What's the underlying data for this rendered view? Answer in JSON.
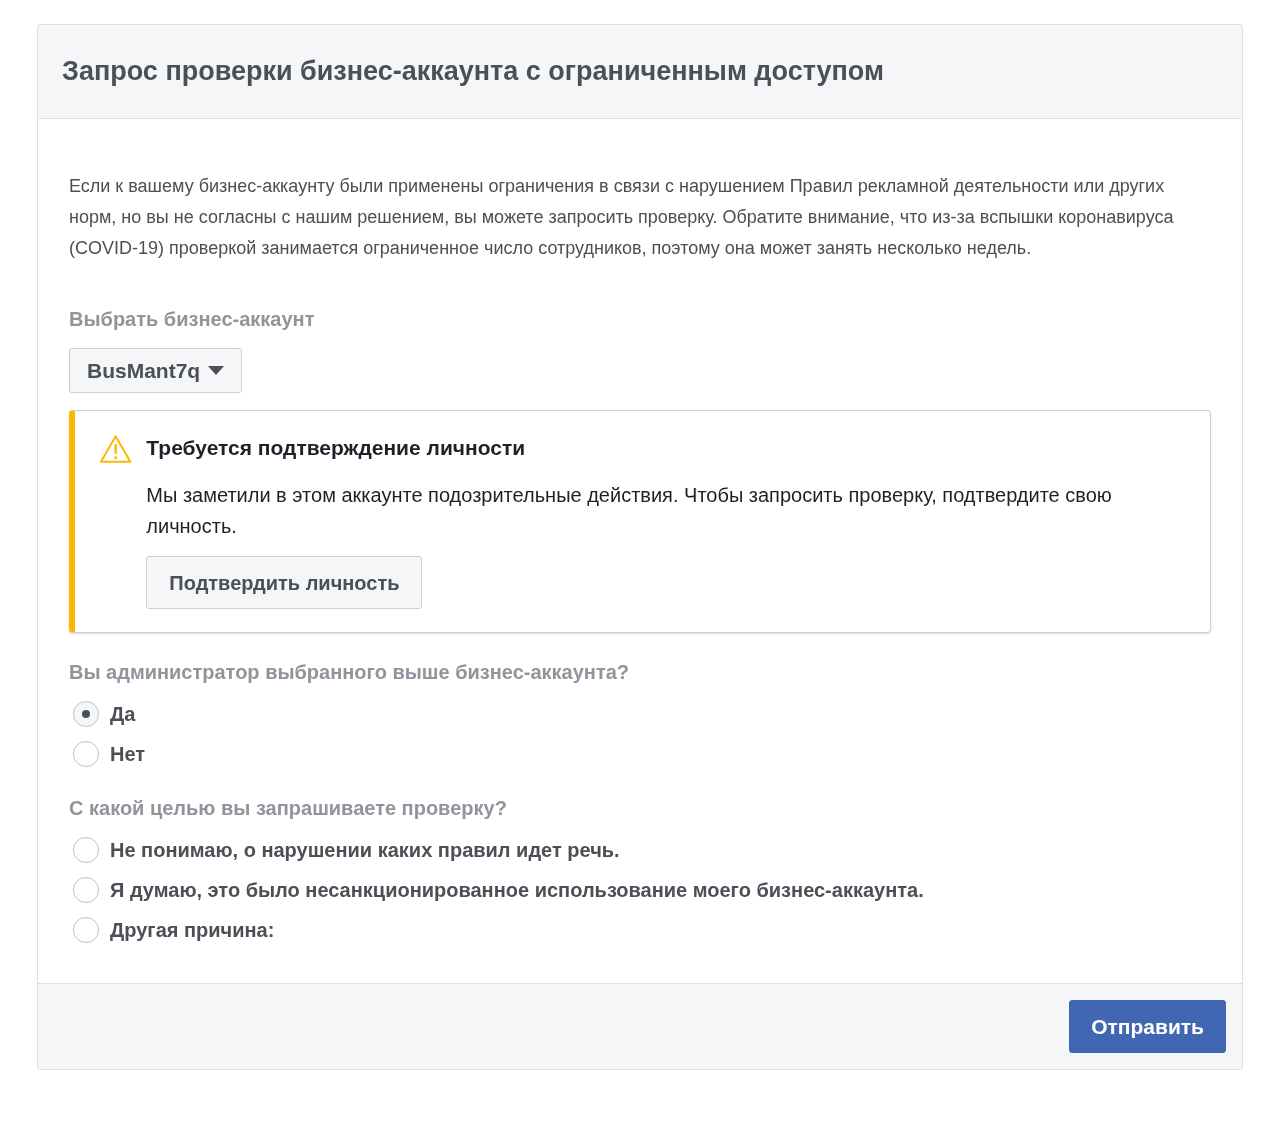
{
  "dialog": {
    "title": "Запрос проверки бизнес-аккаунта с ограниченным доступом"
  },
  "intro": "Если к вашему бизнес-аккаунту были применены ограничения в связи с нарушением Правил рекламной деятельности или других норм, но вы не согласны с нашим решением, вы можете запросить проверку. Обратите внимание, что из-за вспышки коронавируса (COVID-19) проверкой занимается ограниченное число сотрудников, поэтому она может занять несколько недель.",
  "account_select": {
    "label": "Выбрать бизнес-аккаунт",
    "value": "BusMant7q"
  },
  "alert": {
    "title": "Требуется подтверждение личности",
    "message": "Мы заметили в этом аккаунте подозрительные действия. Чтобы запросить проверку, подтвердите свою личность.",
    "button": "Подтвердить личность"
  },
  "questions": [
    {
      "label": "Вы администратор выбранного выше бизнес-аккаунта?",
      "options": [
        {
          "label": "Да",
          "selected": true
        },
        {
          "label": "Нет",
          "selected": false
        }
      ]
    },
    {
      "label": "С какой целью вы запрашиваете проверку?",
      "options": [
        {
          "label": "Не понимаю, о нарушении каких правил идет речь.",
          "selected": false
        },
        {
          "label": "Я думаю, это было несанкционированное использование моего бизнес-аккаунта.",
          "selected": false
        },
        {
          "label": "Другая причина:",
          "selected": false
        }
      ]
    }
  ],
  "submit_button": "Отправить"
}
